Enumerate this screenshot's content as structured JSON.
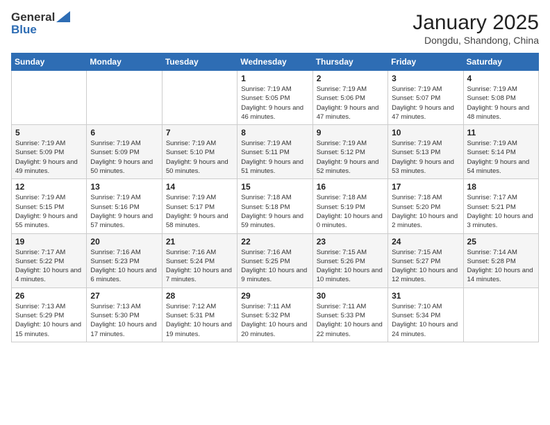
{
  "logo": {
    "line1": "General",
    "line2": "Blue"
  },
  "header": {
    "month": "January 2025",
    "location": "Dongdu, Shandong, China"
  },
  "weekdays": [
    "Sunday",
    "Monday",
    "Tuesday",
    "Wednesday",
    "Thursday",
    "Friday",
    "Saturday"
  ],
  "weeks": [
    [
      {
        "day": "",
        "info": ""
      },
      {
        "day": "",
        "info": ""
      },
      {
        "day": "",
        "info": ""
      },
      {
        "day": "1",
        "info": "Sunrise: 7:19 AM\nSunset: 5:05 PM\nDaylight: 9 hours and 46 minutes."
      },
      {
        "day": "2",
        "info": "Sunrise: 7:19 AM\nSunset: 5:06 PM\nDaylight: 9 hours and 47 minutes."
      },
      {
        "day": "3",
        "info": "Sunrise: 7:19 AM\nSunset: 5:07 PM\nDaylight: 9 hours and 47 minutes."
      },
      {
        "day": "4",
        "info": "Sunrise: 7:19 AM\nSunset: 5:08 PM\nDaylight: 9 hours and 48 minutes."
      }
    ],
    [
      {
        "day": "5",
        "info": "Sunrise: 7:19 AM\nSunset: 5:09 PM\nDaylight: 9 hours and 49 minutes."
      },
      {
        "day": "6",
        "info": "Sunrise: 7:19 AM\nSunset: 5:09 PM\nDaylight: 9 hours and 50 minutes."
      },
      {
        "day": "7",
        "info": "Sunrise: 7:19 AM\nSunset: 5:10 PM\nDaylight: 9 hours and 50 minutes."
      },
      {
        "day": "8",
        "info": "Sunrise: 7:19 AM\nSunset: 5:11 PM\nDaylight: 9 hours and 51 minutes."
      },
      {
        "day": "9",
        "info": "Sunrise: 7:19 AM\nSunset: 5:12 PM\nDaylight: 9 hours and 52 minutes."
      },
      {
        "day": "10",
        "info": "Sunrise: 7:19 AM\nSunset: 5:13 PM\nDaylight: 9 hours and 53 minutes."
      },
      {
        "day": "11",
        "info": "Sunrise: 7:19 AM\nSunset: 5:14 PM\nDaylight: 9 hours and 54 minutes."
      }
    ],
    [
      {
        "day": "12",
        "info": "Sunrise: 7:19 AM\nSunset: 5:15 PM\nDaylight: 9 hours and 55 minutes."
      },
      {
        "day": "13",
        "info": "Sunrise: 7:19 AM\nSunset: 5:16 PM\nDaylight: 9 hours and 57 minutes."
      },
      {
        "day": "14",
        "info": "Sunrise: 7:19 AM\nSunset: 5:17 PM\nDaylight: 9 hours and 58 minutes."
      },
      {
        "day": "15",
        "info": "Sunrise: 7:18 AM\nSunset: 5:18 PM\nDaylight: 9 hours and 59 minutes."
      },
      {
        "day": "16",
        "info": "Sunrise: 7:18 AM\nSunset: 5:19 PM\nDaylight: 10 hours and 0 minutes."
      },
      {
        "day": "17",
        "info": "Sunrise: 7:18 AM\nSunset: 5:20 PM\nDaylight: 10 hours and 2 minutes."
      },
      {
        "day": "18",
        "info": "Sunrise: 7:17 AM\nSunset: 5:21 PM\nDaylight: 10 hours and 3 minutes."
      }
    ],
    [
      {
        "day": "19",
        "info": "Sunrise: 7:17 AM\nSunset: 5:22 PM\nDaylight: 10 hours and 4 minutes."
      },
      {
        "day": "20",
        "info": "Sunrise: 7:16 AM\nSunset: 5:23 PM\nDaylight: 10 hours and 6 minutes."
      },
      {
        "day": "21",
        "info": "Sunrise: 7:16 AM\nSunset: 5:24 PM\nDaylight: 10 hours and 7 minutes."
      },
      {
        "day": "22",
        "info": "Sunrise: 7:16 AM\nSunset: 5:25 PM\nDaylight: 10 hours and 9 minutes."
      },
      {
        "day": "23",
        "info": "Sunrise: 7:15 AM\nSunset: 5:26 PM\nDaylight: 10 hours and 10 minutes."
      },
      {
        "day": "24",
        "info": "Sunrise: 7:15 AM\nSunset: 5:27 PM\nDaylight: 10 hours and 12 minutes."
      },
      {
        "day": "25",
        "info": "Sunrise: 7:14 AM\nSunset: 5:28 PM\nDaylight: 10 hours and 14 minutes."
      }
    ],
    [
      {
        "day": "26",
        "info": "Sunrise: 7:13 AM\nSunset: 5:29 PM\nDaylight: 10 hours and 15 minutes."
      },
      {
        "day": "27",
        "info": "Sunrise: 7:13 AM\nSunset: 5:30 PM\nDaylight: 10 hours and 17 minutes."
      },
      {
        "day": "28",
        "info": "Sunrise: 7:12 AM\nSunset: 5:31 PM\nDaylight: 10 hours and 19 minutes."
      },
      {
        "day": "29",
        "info": "Sunrise: 7:11 AM\nSunset: 5:32 PM\nDaylight: 10 hours and 20 minutes."
      },
      {
        "day": "30",
        "info": "Sunrise: 7:11 AM\nSunset: 5:33 PM\nDaylight: 10 hours and 22 minutes."
      },
      {
        "day": "31",
        "info": "Sunrise: 7:10 AM\nSunset: 5:34 PM\nDaylight: 10 hours and 24 minutes."
      },
      {
        "day": "",
        "info": ""
      }
    ]
  ]
}
